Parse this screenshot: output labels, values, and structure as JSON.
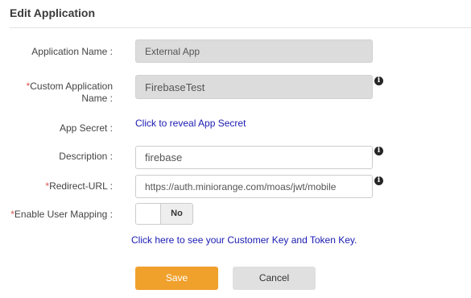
{
  "page": {
    "title": "Edit Application"
  },
  "form": {
    "application_name": {
      "label": "Application Name :",
      "value": "External App"
    },
    "custom_application_name": {
      "required_mark": "*",
      "label_line1": "Custom Application",
      "label_line2": "Name :",
      "value": "FirebaseTest"
    },
    "app_secret": {
      "label": "App Secret :",
      "link": "Click to reveal App Secret"
    },
    "description": {
      "label": "Description :",
      "value": "firebase"
    },
    "redirect_url": {
      "required_mark": "*",
      "label": "Redirect-URL :",
      "value": "https://auth.miniorange.com/moas/jwt/mobile"
    },
    "enable_user_mapping": {
      "required_mark": "*",
      "label": "Enable User Mapping :",
      "state": "No"
    },
    "customer_key_link": "Click here to see your Customer Key and Token Key."
  },
  "info_icon_glyph": "i",
  "buttons": {
    "save": "Save",
    "cancel": "Cancel"
  },
  "colors": {
    "save_button": "#f0a12c",
    "cancel_button": "#e0e0e0",
    "link": "#1a1ab3",
    "required": "#d9534f",
    "disabled_field": "#dcdcdc"
  }
}
